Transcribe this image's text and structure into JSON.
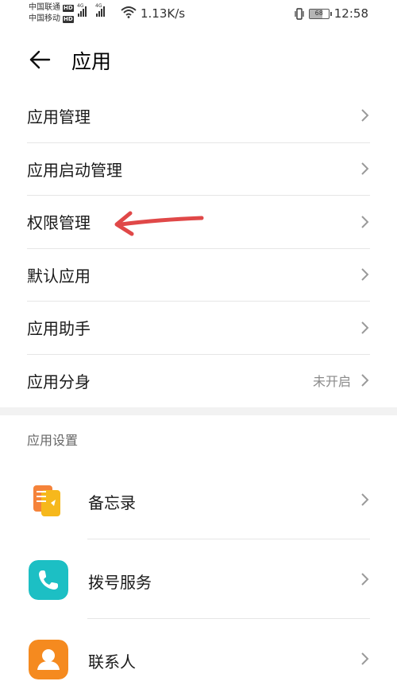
{
  "status_bar": {
    "carrier1": "中国联通",
    "carrier2": "中国移动",
    "hd": "HD",
    "network": "4G",
    "speed": "1.13K/s",
    "battery": "68",
    "battery_level": 0.68,
    "time": "12:58"
  },
  "header": {
    "title": "应用",
    "back_icon": "arrow-left-icon"
  },
  "menu": {
    "items": [
      {
        "label": "应用管理",
        "value": ""
      },
      {
        "label": "应用启动管理",
        "value": ""
      },
      {
        "label": "权限管理",
        "value": ""
      },
      {
        "label": "默认应用",
        "value": ""
      },
      {
        "label": "应用助手",
        "value": ""
      },
      {
        "label": "应用分身",
        "value": "未开启"
      }
    ]
  },
  "section": {
    "title": "应用设置"
  },
  "apps": [
    {
      "label": "备忘录",
      "icon": "memo-icon",
      "color": "#f5a623"
    },
    {
      "label": "拨号服务",
      "icon": "phone-icon",
      "color": "#1cbfc4"
    },
    {
      "label": "联系人",
      "icon": "contact-icon",
      "color": "#f58a1f"
    }
  ],
  "annotation_color": "#e04848"
}
